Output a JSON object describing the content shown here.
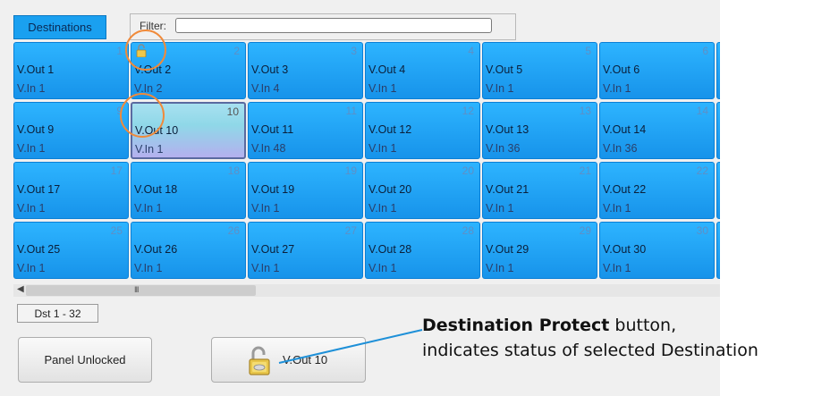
{
  "tabs": {
    "destinations": "Destinations"
  },
  "filter": {
    "label": "Filter:",
    "value": ""
  },
  "cells": [
    {
      "num": "1",
      "out": "V.Out 1",
      "in": "V.In 1"
    },
    {
      "num": "2",
      "out": "V.Out 2",
      "in": "V.In 2",
      "locked": true
    },
    {
      "num": "3",
      "out": "V.Out 3",
      "in": "V.In 4"
    },
    {
      "num": "4",
      "out": "V.Out 4",
      "in": "V.In 1"
    },
    {
      "num": "5",
      "out": "V.Out 5",
      "in": "V.In 1"
    },
    {
      "num": "6",
      "out": "V.Out 6",
      "in": "V.In 1"
    },
    {
      "num": "9",
      "out": "V.Out 9",
      "in": "V.In 1"
    },
    {
      "num": "10",
      "out": "V.Out 10",
      "in": "V.In 1",
      "selected": true
    },
    {
      "num": "11",
      "out": "V.Out 11",
      "in": "V.In 48"
    },
    {
      "num": "12",
      "out": "V.Out 12",
      "in": "V.In 1"
    },
    {
      "num": "13",
      "out": "V.Out 13",
      "in": "V.In 36"
    },
    {
      "num": "14",
      "out": "V.Out 14",
      "in": "V.In 36"
    },
    {
      "num": "17",
      "out": "V.Out 17",
      "in": "V.In 1"
    },
    {
      "num": "18",
      "out": "V.Out 18",
      "in": "V.In 1"
    },
    {
      "num": "19",
      "out": "V.Out 19",
      "in": "V.In 1"
    },
    {
      "num": "20",
      "out": "V.Out 20",
      "in": "V.In 1"
    },
    {
      "num": "21",
      "out": "V.Out 21",
      "in": "V.In 1"
    },
    {
      "num": "22",
      "out": "V.Out 22",
      "in": "V.In 1"
    },
    {
      "num": "25",
      "out": "V.Out 25",
      "in": "V.In 1"
    },
    {
      "num": "26",
      "out": "V.Out 26",
      "in": "V.In 1"
    },
    {
      "num": "27",
      "out": "V.Out 27",
      "in": "V.In 1"
    },
    {
      "num": "28",
      "out": "V.Out 28",
      "in": "V.In 1"
    },
    {
      "num": "29",
      "out": "V.Out 29",
      "in": "V.In 1"
    },
    {
      "num": "30",
      "out": "V.Out 30",
      "in": "V.In 1"
    }
  ],
  "scrollbar": {
    "grip": "III"
  },
  "range": "Dst 1 - 32",
  "buttons": {
    "panel_lock": "Panel Unlocked",
    "protect": "V.Out 10"
  },
  "callout": {
    "bold": "Destination Protect",
    "rest": " button,",
    "line2": "indicates status of selected Destination"
  },
  "colors": {
    "cell": "#1a9cf0",
    "selected": "#9fdde9",
    "highlight_circle": "#f08a3a",
    "callout_line": "#1e90d8"
  }
}
